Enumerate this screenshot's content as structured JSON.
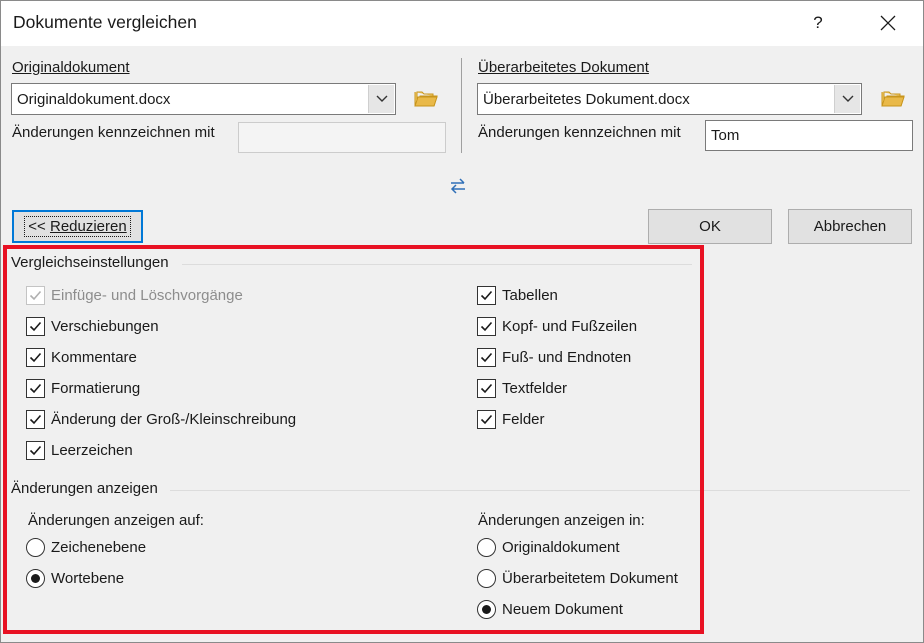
{
  "dialog": {
    "title": "Dokumente vergleichen",
    "help_glyph": "?",
    "close_glyph": "✕"
  },
  "original": {
    "group_label": "Originaldokument",
    "combo_value": "Originaldokument.docx",
    "mark_label": "Änderungen kennzeichnen mit",
    "mark_value": ""
  },
  "revised": {
    "group_label": "Überarbeitetes Dokument",
    "combo_value": "Überarbeitetes Dokument.docx",
    "mark_label": "Änderungen kennzeichnen mit",
    "mark_value": "Tom"
  },
  "icons": {
    "folder": "folder-open-icon",
    "swap": "swap-arrows-icon",
    "dropdown": "chevron-down-icon",
    "checkmark": "checkmark-icon"
  },
  "buttons": {
    "reduce_arrows": "<< ",
    "reduce_label": "Reduzieren",
    "ok": "OK",
    "cancel": "Abbrechen"
  },
  "settings": {
    "heading": "Vergleichseinstellungen",
    "left": [
      {
        "label": "Einfüge- und Löschvorgänge",
        "checked": true,
        "disabled": true
      },
      {
        "label": "Verschiebungen",
        "checked": true,
        "disabled": false
      },
      {
        "label": "Kommentare",
        "checked": true,
        "disabled": false
      },
      {
        "label": "Formatierung",
        "checked": true,
        "disabled": false
      },
      {
        "label": "Änderung der Groß-/Kleinschreibung",
        "checked": true,
        "disabled": false
      },
      {
        "label": "Leerzeichen",
        "checked": true,
        "disabled": false
      }
    ],
    "right": [
      {
        "label": "Tabellen",
        "checked": true
      },
      {
        "label": "Kopf- und Fußzeilen",
        "checked": true
      },
      {
        "label": "Fuß- und Endnoten",
        "checked": true
      },
      {
        "label": "Textfelder",
        "checked": true
      },
      {
        "label": "Felder",
        "checked": true
      }
    ]
  },
  "show_changes": {
    "heading": "Änderungen anzeigen",
    "level_label": "Änderungen anzeigen auf:",
    "level_options": [
      {
        "label": "Zeichenebene",
        "selected": false
      },
      {
        "label": "Wortebene",
        "selected": true
      }
    ],
    "target_label": "Änderungen anzeigen in:",
    "target_options": [
      {
        "label": "Originaldokument",
        "selected": false
      },
      {
        "label": "Überarbeitetem Dokument",
        "selected": false
      },
      {
        "label": "Neuem Dokument",
        "selected": true
      }
    ]
  },
  "colors": {
    "accent_focus": "#0078d7",
    "highlight_frame": "#e81123",
    "folder": "#e9b949",
    "swap_arrows": "#2f6fb7"
  }
}
